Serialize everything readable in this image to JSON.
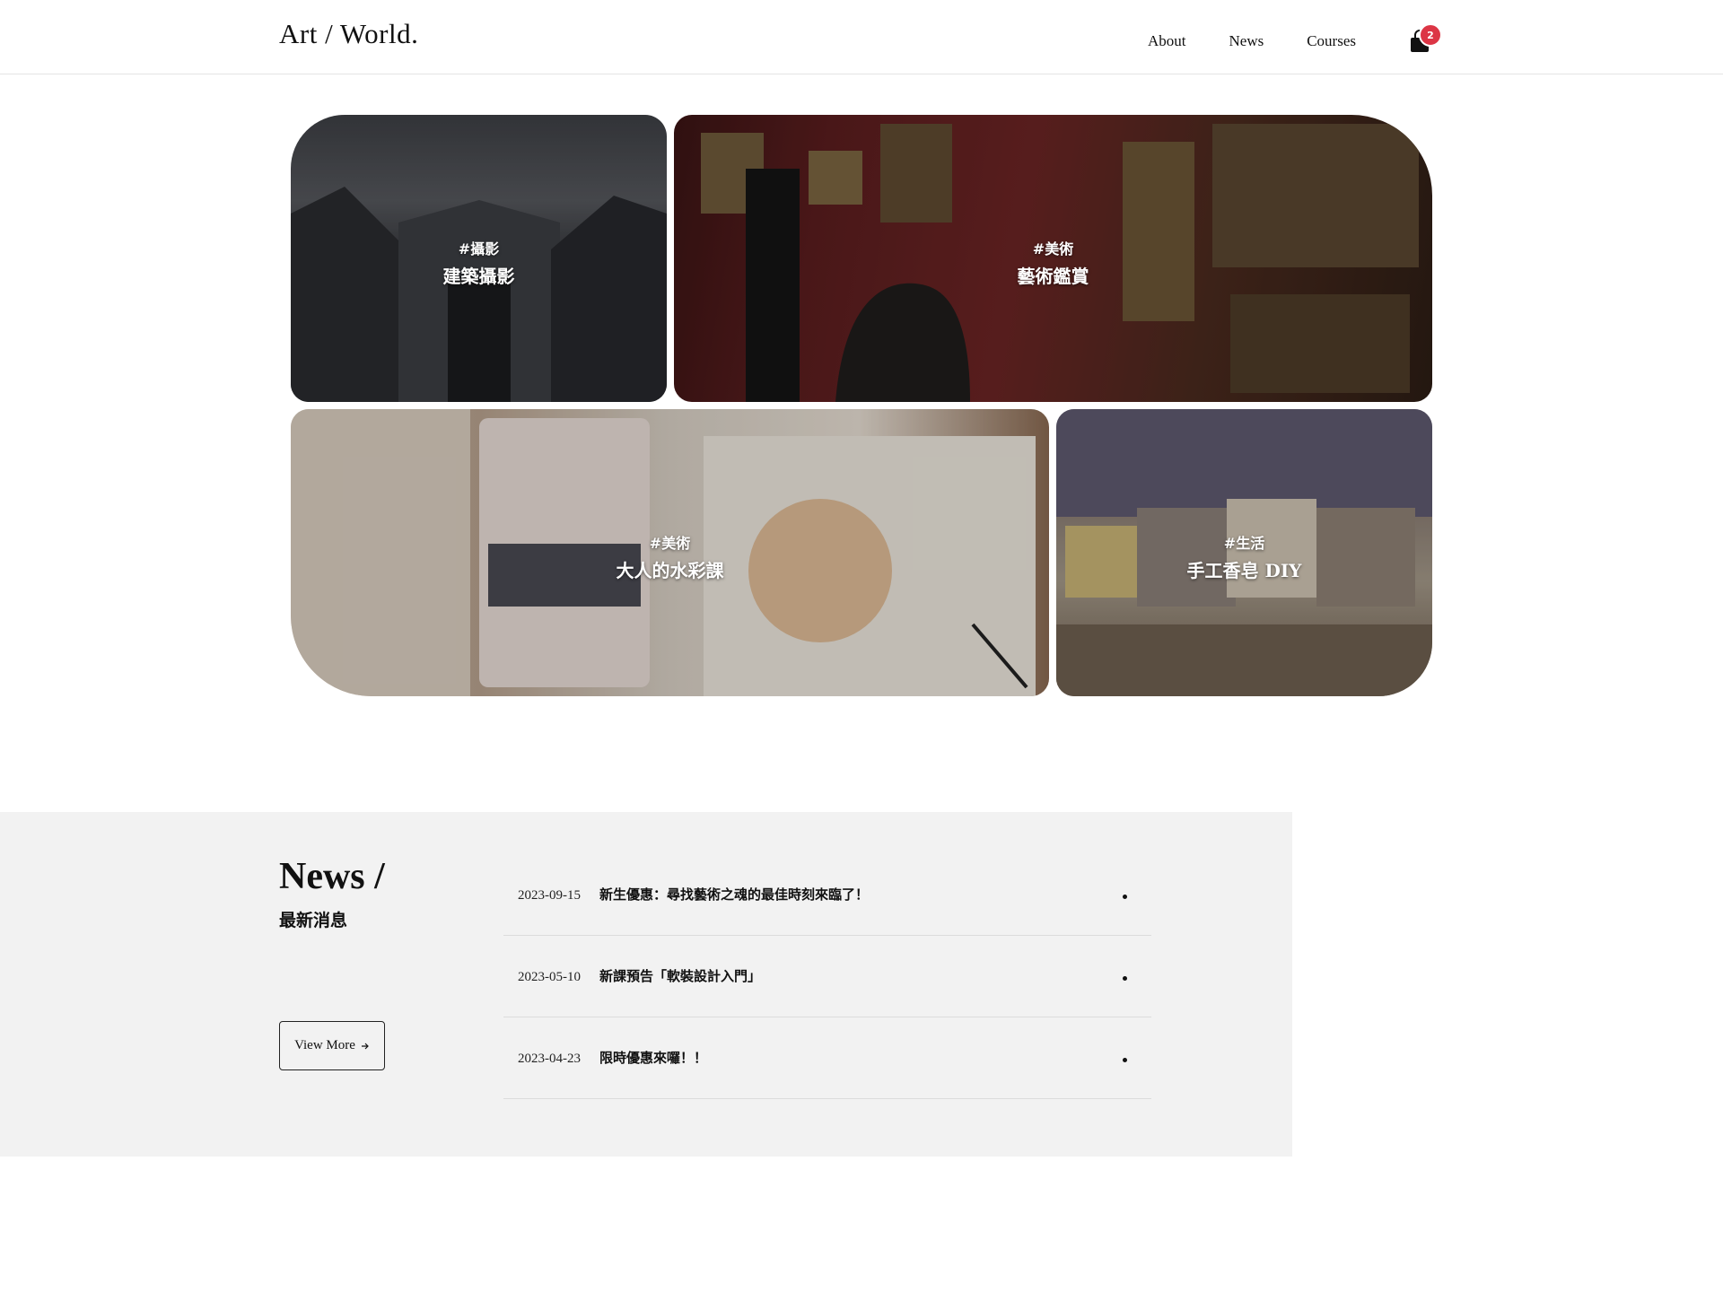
{
  "header": {
    "logo": "Art / World.",
    "nav": [
      "About",
      "News",
      "Courses"
    ],
    "cart_count": "2"
  },
  "gallery": [
    {
      "tag": "#攝影",
      "title": "建築攝影"
    },
    {
      "tag": "#美術",
      "title": "藝術鑑賞"
    },
    {
      "tag": "#美術",
      "title": "大人的水彩課"
    },
    {
      "tag": "#生活",
      "title": "手工香皂 DIY"
    }
  ],
  "news": {
    "heading": "News /",
    "subheading": "最新消息",
    "view_more": "View More",
    "items": [
      {
        "date": "2023-09-15",
        "title": "新生優惠：尋找藝術之魂的最佳時刻來臨了！"
      },
      {
        "date": "2023-05-10",
        "title": "新課預告「軟裝設計入門」"
      },
      {
        "date": "2023-04-23",
        "title": "限時優惠來囉！！"
      }
    ]
  }
}
